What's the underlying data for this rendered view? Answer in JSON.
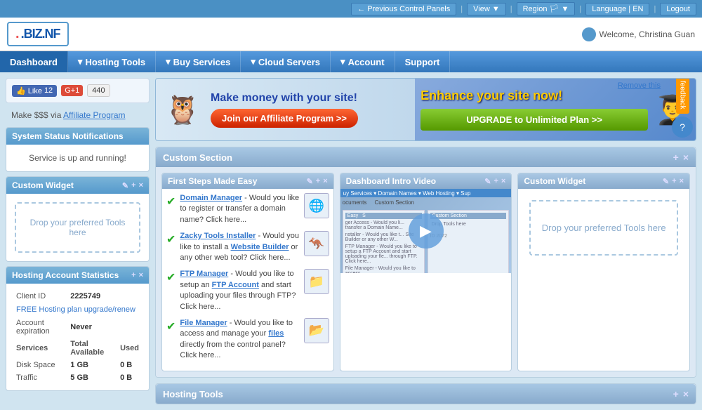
{
  "topbar": {
    "prev_panels": "Previous Control Panels",
    "view": "View",
    "region": "Region",
    "language": "Language | EN",
    "logout": "Logout"
  },
  "header": {
    "logo": ".BIZ.NF",
    "welcome": "Welcome, Christina Guan"
  },
  "nav": {
    "items": [
      {
        "label": "Dashboard",
        "arrow": false
      },
      {
        "label": "Hosting Tools",
        "arrow": true
      },
      {
        "label": "Buy Services",
        "arrow": true
      },
      {
        "label": "Cloud Servers",
        "arrow": true
      },
      {
        "label": "Account",
        "arrow": true
      },
      {
        "label": "Support",
        "arrow": true
      }
    ]
  },
  "sidebar": {
    "social": {
      "like_label": "Like",
      "like_count": "12",
      "gplus_label": "G+1",
      "count": "440"
    },
    "affiliate_text": "Make $$$ via",
    "affiliate_link": "Affiliate Program",
    "system_status": {
      "title": "System Status Notifications",
      "message": "Service is up and running!"
    },
    "custom_widget": {
      "title": "Custom Widget",
      "drop_text": "Drop your preferred Tools here"
    },
    "hosting_stats": {
      "title": "Hosting Account Statistics",
      "client_id_label": "Client ID",
      "client_id": "2225749",
      "plan_label": "FREE Hosting plan upgrade/renew",
      "expiry_label": "Account expiration",
      "expiry_val": "Never",
      "columns": [
        "Services",
        "Total Available",
        "Used"
      ],
      "rows": [
        {
          "service": "Disk Space",
          "total": "1 GB",
          "used": "0 B"
        },
        {
          "service": "Traffic",
          "total": "5 GB",
          "used": "0 B"
        }
      ]
    }
  },
  "banner": {
    "left_title": "Make money with your site!",
    "left_btn": "Join our Affiliate Program >>",
    "right_title": "Enhance your site now!",
    "right_btn": "UPGRADE to Unlimited Plan >>",
    "remove_label": "Remove this",
    "feedback_label": "feedback",
    "support_label": "support"
  },
  "custom_section": {
    "title": "Custom Section"
  },
  "first_steps": {
    "title": "First Steps Made Easy",
    "items": [
      {
        "title": "Domain Manager",
        "text": " - Would you like to register or transfer a domain name? Click here...",
        "icon": "🌐"
      },
      {
        "title": "Zacky Tools Installer",
        "text": " - Would you like to install a Website Builder or any other web tool? Click here...",
        "icon": "🦘"
      },
      {
        "title": "FTP Manager",
        "text": " - Would you like to setup an FTP Account and start uploading your files through FTP? Click here...",
        "icon": "📁"
      },
      {
        "title": "File Manager",
        "text": " - Would you like to access and manage your files directly from the control panel? Click here...",
        "icon": "📂"
      }
    ]
  },
  "dashboard_video": {
    "title": "Dashboard Intro Video"
  },
  "custom_widget_main": {
    "title": "Custom Widget",
    "drop_text": "Drop your preferred Tools here"
  },
  "hosting_tools_section": {
    "title": "Hosting Tools"
  }
}
